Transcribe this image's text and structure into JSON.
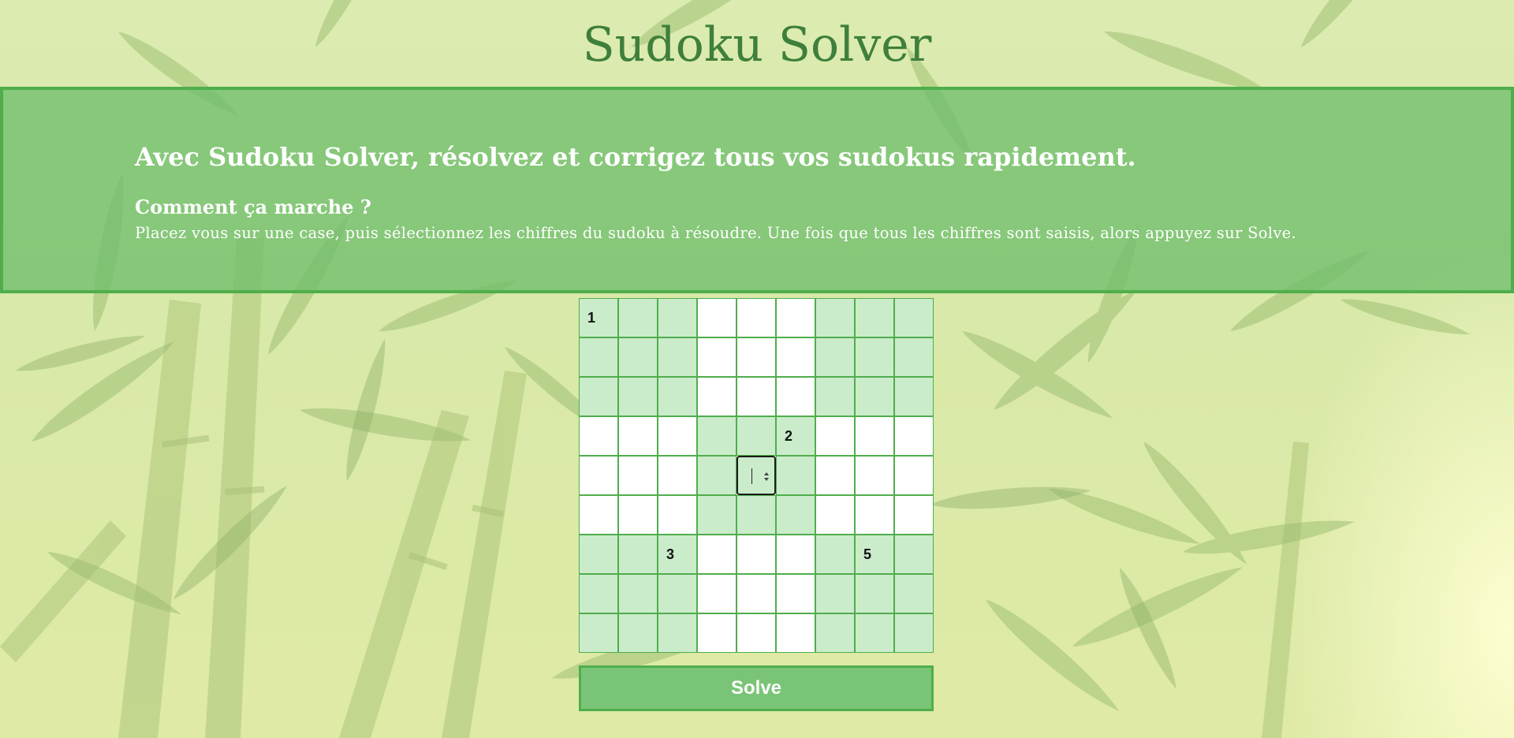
{
  "page": {
    "title": "Sudoku Solver"
  },
  "banner": {
    "headline": "Avec Sudoku Solver, résolvez et corrigez tous vos sudokus rapidement.",
    "subhead": "Comment ça marche ?",
    "instructions": "Placez vous sur une case, puis sélectionnez les chiffres du sudoku à résoudre. Une fois que tous les chiffres sont saisis, alors appuyez sur Solve."
  },
  "grid": {
    "rows": [
      [
        "1",
        "",
        "",
        "",
        "",
        "",
        "",
        "",
        ""
      ],
      [
        "",
        "",
        "",
        "",
        "",
        "",
        "",
        "",
        ""
      ],
      [
        "",
        "",
        "",
        "",
        "",
        "",
        "",
        "",
        ""
      ],
      [
        "",
        "",
        "",
        "",
        "",
        "2",
        "",
        "",
        ""
      ],
      [
        "",
        "",
        "",
        "",
        "",
        "",
        "",
        "",
        ""
      ],
      [
        "",
        "",
        "",
        "",
        "",
        "",
        "",
        "",
        ""
      ],
      [
        "",
        "",
        "3",
        "",
        "",
        "",
        "",
        "5",
        ""
      ],
      [
        "",
        "",
        "",
        "",
        "",
        "",
        "",
        "",
        ""
      ],
      [
        "",
        "",
        "",
        "",
        "",
        "",
        "",
        "",
        ""
      ]
    ],
    "active_cell": {
      "row": 4,
      "col": 4
    },
    "colors": {
      "shaded": "#caeccb",
      "plain": "#ffffff",
      "border": "#4fae4b"
    }
  },
  "solve_button": {
    "label": "Solve"
  },
  "colors": {
    "title": "#3f7f3c",
    "banner_bg": "#70be6c",
    "banner_border": "#4fae4b",
    "button_bg": "#7ac477"
  }
}
